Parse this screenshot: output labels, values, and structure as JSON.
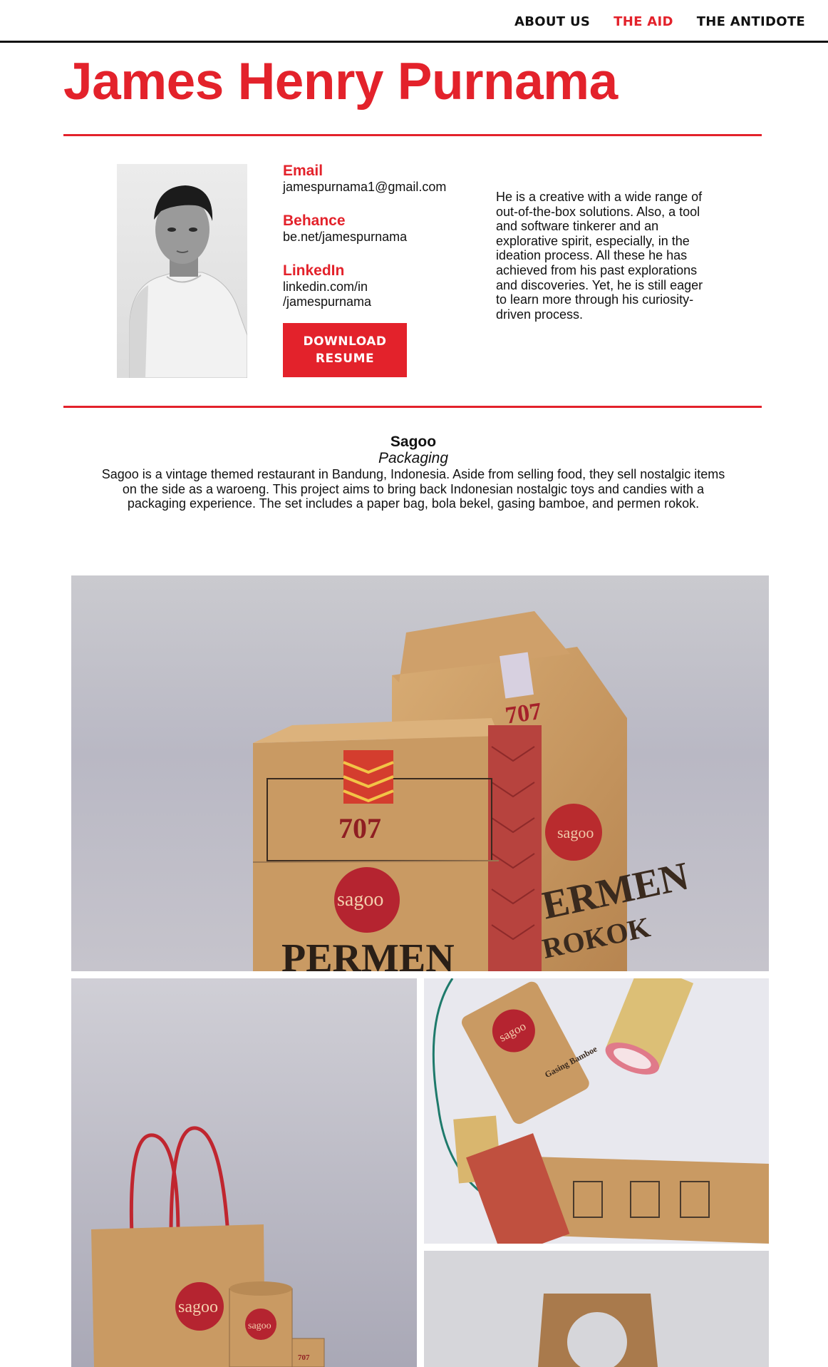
{
  "nav": {
    "links": [
      {
        "label": "ABOUT US"
      },
      {
        "label": "THE AID"
      },
      {
        "label": "THE ANTIDOTE"
      }
    ]
  },
  "profile": {
    "name": "James Henry Purnama",
    "contacts": [
      {
        "label": "Email",
        "value": "jamespurnama1@gmail.com"
      },
      {
        "label": "Behance",
        "value": "be.net/jamespurnama"
      },
      {
        "label": "LinkedIn",
        "value": "linkedin.com/in /jamespurnama"
      }
    ],
    "download_button": "DOWNLOAD RESUME",
    "bio": "He is a creative with a wide range of out-of-the-box solutions. Also, a tool and software tinkerer and an explorative spirit, especially, in the ideation process. All these he has achieved from his past explorations and discoveries. Yet, he is still eager to learn more through his curiosity-driven process."
  },
  "project": {
    "title": "Sagoo",
    "category": "Packaging",
    "description": "Sagoo is a vintage themed restaurant in Bandung, Indonesia. Aside from selling food, they sell nostalgic items on the side as a waroeng. This project aims to bring back Indonesian nostalgic toys and candies with a packaging experience. The set includes a paper bag, bola bekel, gasing bamboe, and permen rokok.",
    "images": {
      "box": {
        "brand": "sagoo",
        "number": "707",
        "number_back": "707",
        "label_a": "PERMEN",
        "label_b": "ERMEN",
        "label_c": "ROKOK"
      },
      "gasing": {
        "brand": "sagoo",
        "label": "Gasing Bamboe"
      },
      "bag": {
        "brand": "sagoo",
        "brand_small": "sagoo",
        "number": "707"
      }
    }
  },
  "colors": {
    "accent": "#e3222b",
    "text": "#111111",
    "kraft": "#c99a63"
  }
}
